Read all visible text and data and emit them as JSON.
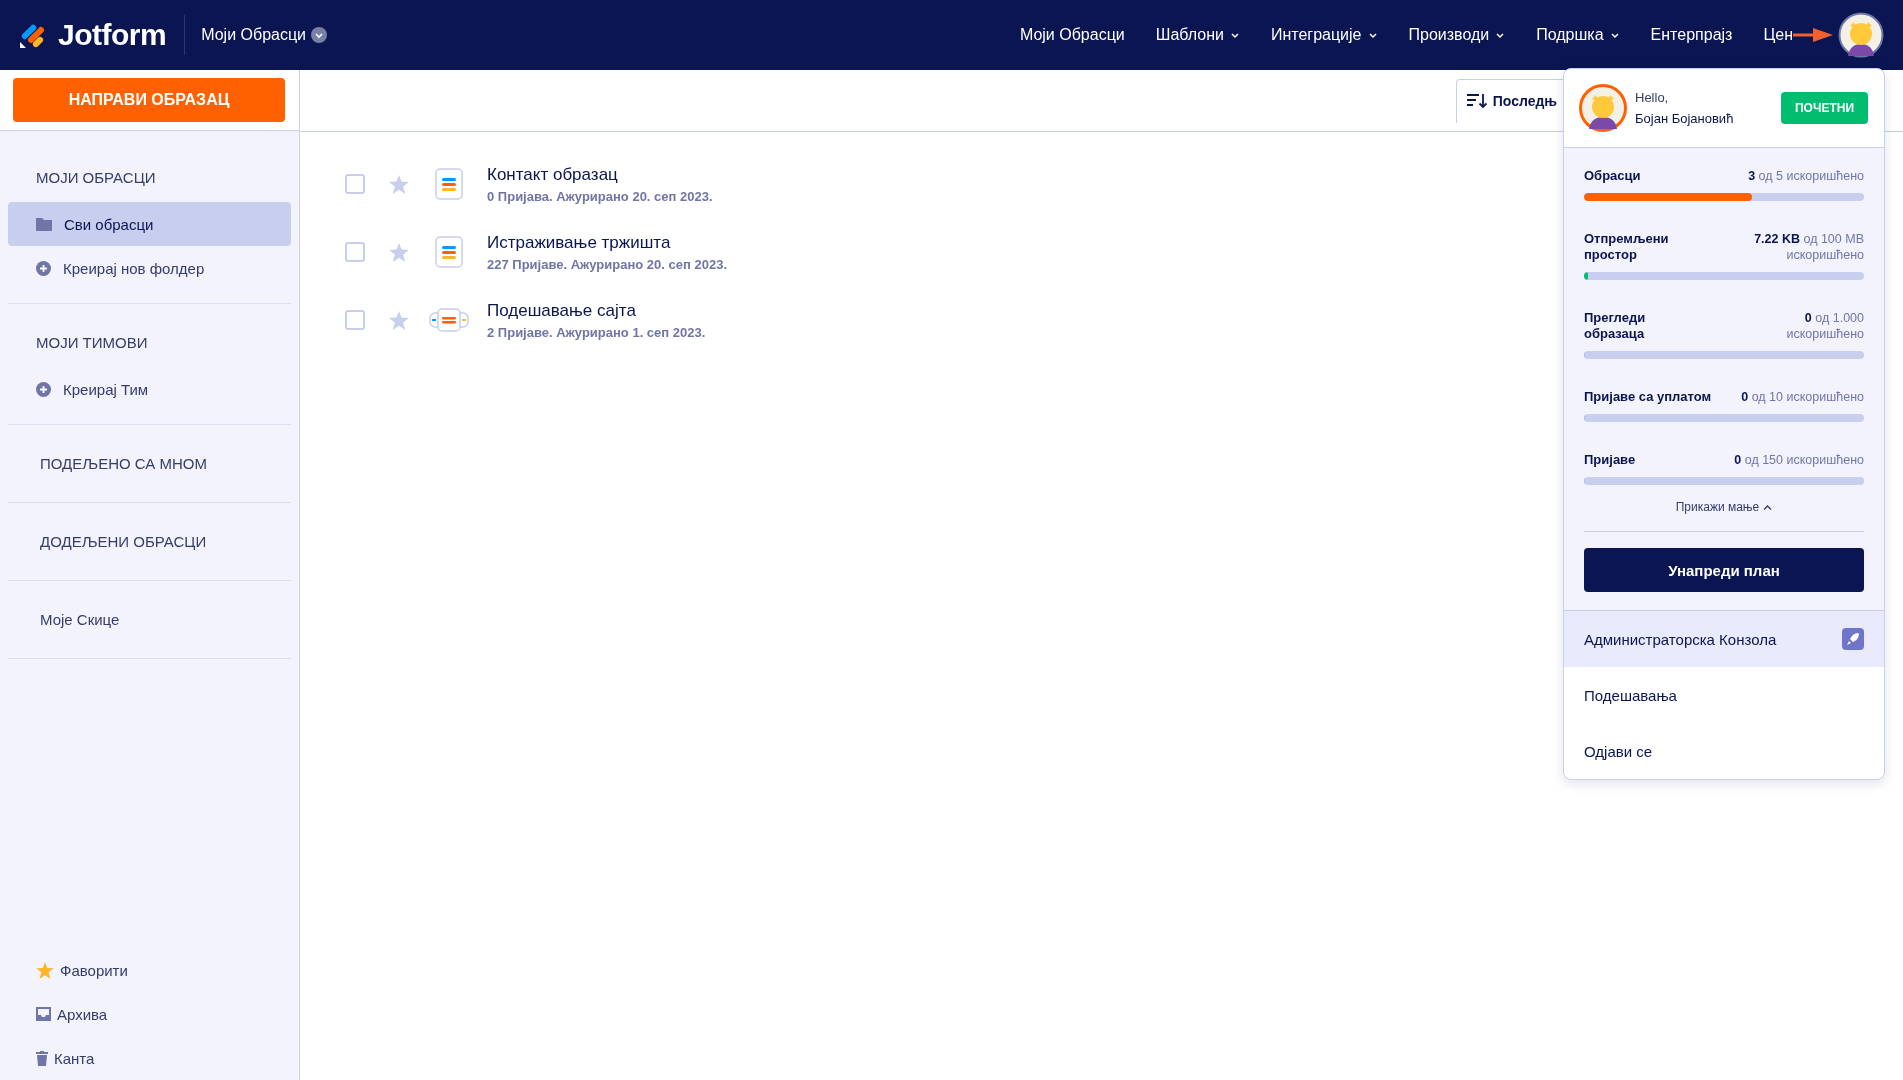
{
  "header": {
    "logo": "Jotform",
    "workspace": "Моји Обрасци",
    "nav": [
      {
        "label": "Моји Обрасци",
        "dropdown": false
      },
      {
        "label": "Шаблони",
        "dropdown": true
      },
      {
        "label": "Интеграције",
        "dropdown": true
      },
      {
        "label": "Производи",
        "dropdown": true
      },
      {
        "label": "Подршка",
        "dropdown": true
      },
      {
        "label": "Ентерпрајз",
        "dropdown": false
      },
      {
        "label": "Цен",
        "dropdown": false
      }
    ]
  },
  "create_button": "НАПРАВИ ОБРАЗАЦ",
  "sidebar": {
    "sections": [
      {
        "kind": "group",
        "title": "МОЈИ ОБРАСЦИ",
        "items": [
          {
            "label": "Сви обрасци",
            "kind": "folder",
            "selected": true
          },
          {
            "label": "Креирај нов фолдер",
            "kind": "add",
            "selected": false
          }
        ]
      },
      {
        "kind": "group",
        "title": "МОЈИ ТИМОВИ",
        "items": [
          {
            "label": "Креирај Тим",
            "kind": "add",
            "selected": false
          }
        ]
      },
      {
        "kind": "link",
        "title": "ПОДЕЉЕНО СА МНОМ"
      },
      {
        "kind": "link",
        "title": "ДОДЕЉЕНИ ОБРАСЦИ"
      },
      {
        "kind": "link",
        "title": "Моје Скице"
      }
    ],
    "bottom": [
      {
        "label": "Фаворити",
        "kind": "star"
      },
      {
        "label": "Архива",
        "kind": "archive"
      },
      {
        "label": "Канта",
        "kind": "trash"
      }
    ]
  },
  "sort_button": "Последњ",
  "forms": [
    {
      "title": "Контакт образац",
      "meta": "0 Пријава. Ажурирано 20. сеп 2023.",
      "kind": "form",
      "checked": false,
      "starred": false
    },
    {
      "title": "Истраживање тржишта",
      "meta": "227 Пријаве. Ажурирано 20. сеп 2023.",
      "kind": "form",
      "checked": false,
      "starred": false
    },
    {
      "title": "Подешавање сајта",
      "meta": "2 Пријаве. Ажурирано 1. сеп 2023.",
      "kind": "app",
      "checked": false,
      "starred": false
    }
  ],
  "account_menu": {
    "greeting": "Hello,",
    "name": "Бојан Бојановић",
    "plan": "ПОЧЕТНИ",
    "usage": [
      {
        "label": "Обрасци",
        "value": "**3** од 5 искоришћено",
        "level": 0.6,
        "color": "#ff6100"
      },
      {
        "label": "Отпремљени простор",
        "value": "**7.22 KB** од 100 MB искоришћено",
        "level": 0.015,
        "color": "#01bd6f"
      },
      {
        "label": "Прегледи образаца",
        "value": "**0** од 1.000 искоришћено",
        "level": 0
      },
      {
        "label": "Пријаве са уплатом",
        "value": "**0** од 10 искоришћено",
        "level": 0
      },
      {
        "label": "Пријаве",
        "value": "**0** од 150 искоришћено",
        "level": 0
      }
    ],
    "toggle": "Прикажи мање",
    "upgrade": "Унапреди план",
    "links": [
      {
        "label": "Администраторска Конзола",
        "kind": "admin",
        "selected": true
      },
      {
        "label": "Подешавања",
        "kind": "plain",
        "selected": false
      },
      {
        "label": "Одјави се",
        "kind": "plain",
        "selected": false
      }
    ]
  }
}
